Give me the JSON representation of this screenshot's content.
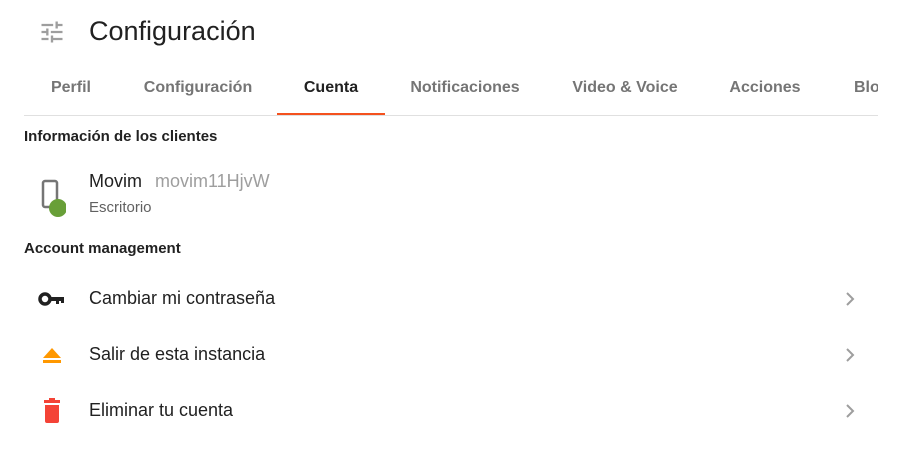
{
  "header": {
    "icon": "tune-icon",
    "title": "Configuración"
  },
  "tabs": [
    {
      "label": "Perfil",
      "active": false
    },
    {
      "label": "Configuración",
      "active": false
    },
    {
      "label": "Cuenta",
      "active": true
    },
    {
      "label": "Notificaciones",
      "active": false
    },
    {
      "label": "Video & Voice",
      "active": false
    },
    {
      "label": "Acciones",
      "active": false
    },
    {
      "label": "Blo",
      "active": false
    }
  ],
  "clients": {
    "title": "Información de los clientes",
    "items": [
      {
        "name": "Movim",
        "jid": "movim11HjvW",
        "type": "Escritorio",
        "icon": "phone-icon",
        "status_color": "#689f38"
      }
    ]
  },
  "account": {
    "title": "Account management",
    "actions": [
      {
        "label": "Cambiar mi contraseña",
        "icon": "key-icon",
        "color": "#212121"
      },
      {
        "label": "Salir de esta instancia",
        "icon": "eject-icon",
        "color": "#ff9800"
      },
      {
        "label": "Eliminar tu cuenta",
        "icon": "trash-icon",
        "color": "#f44336"
      }
    ]
  },
  "colors": {
    "accent": "#f4511e",
    "tab_inactive": "#757575",
    "secondary_text": "#9e9e9e"
  }
}
